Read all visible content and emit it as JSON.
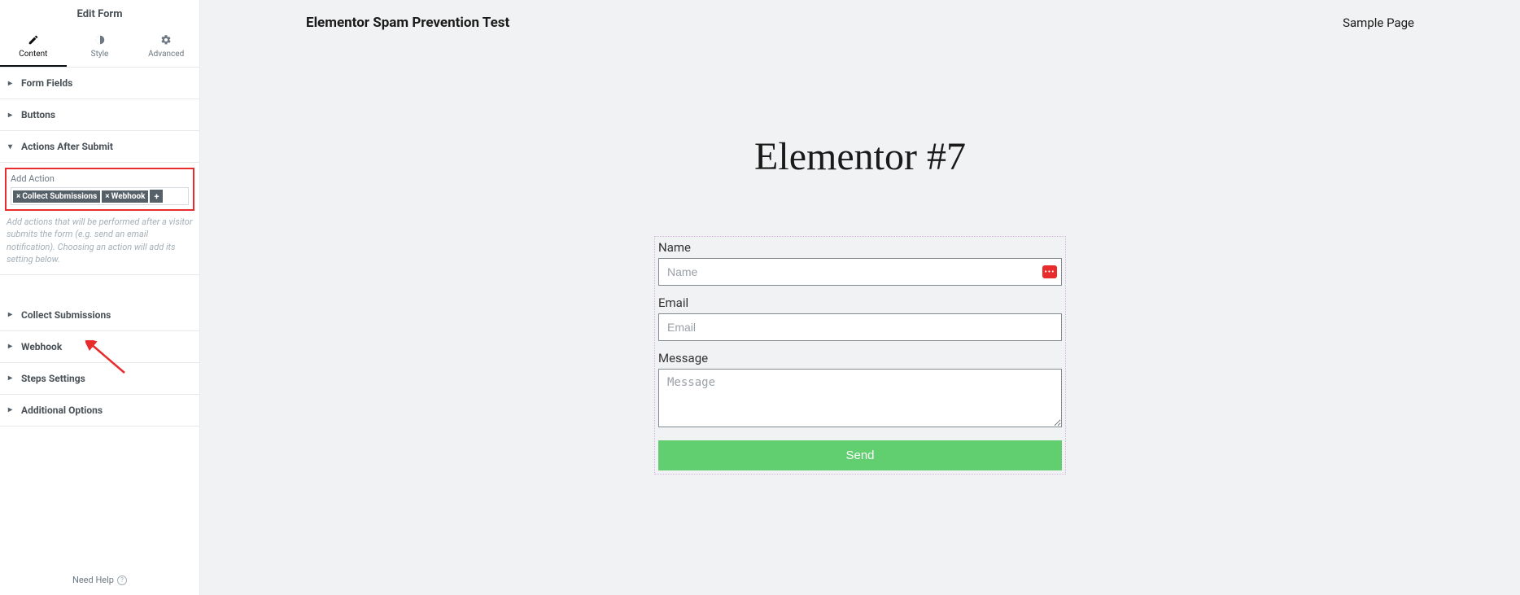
{
  "sidebar": {
    "title": "Edit Form",
    "tabs": [
      {
        "label": "Content"
      },
      {
        "label": "Style"
      },
      {
        "label": "Advanced"
      }
    ],
    "sections": {
      "form_fields": "Form Fields",
      "buttons": "Buttons",
      "actions_after_submit": "Actions After Submit",
      "collect_submissions": "Collect Submissions",
      "webhook": "Webhook",
      "steps_settings": "Steps Settings",
      "additional_options": "Additional Options"
    },
    "add_action_label": "Add Action",
    "action_tags": [
      "Collect Submissions",
      "Webhook"
    ],
    "helper_text": "Add actions that will be performed after a visitor submits the form (e.g. send an email notification). Choosing an action will add its setting below.",
    "need_help": "Need Help"
  },
  "preview": {
    "site_title": "Elementor Spam Prevention Test",
    "sample_page": "Sample Page",
    "page_heading": "Elementor #7",
    "form": {
      "name_label": "Name",
      "name_placeholder": "Name",
      "email_label": "Email",
      "email_placeholder": "Email",
      "message_label": "Message",
      "message_placeholder": "Message",
      "submit": "Send"
    }
  }
}
